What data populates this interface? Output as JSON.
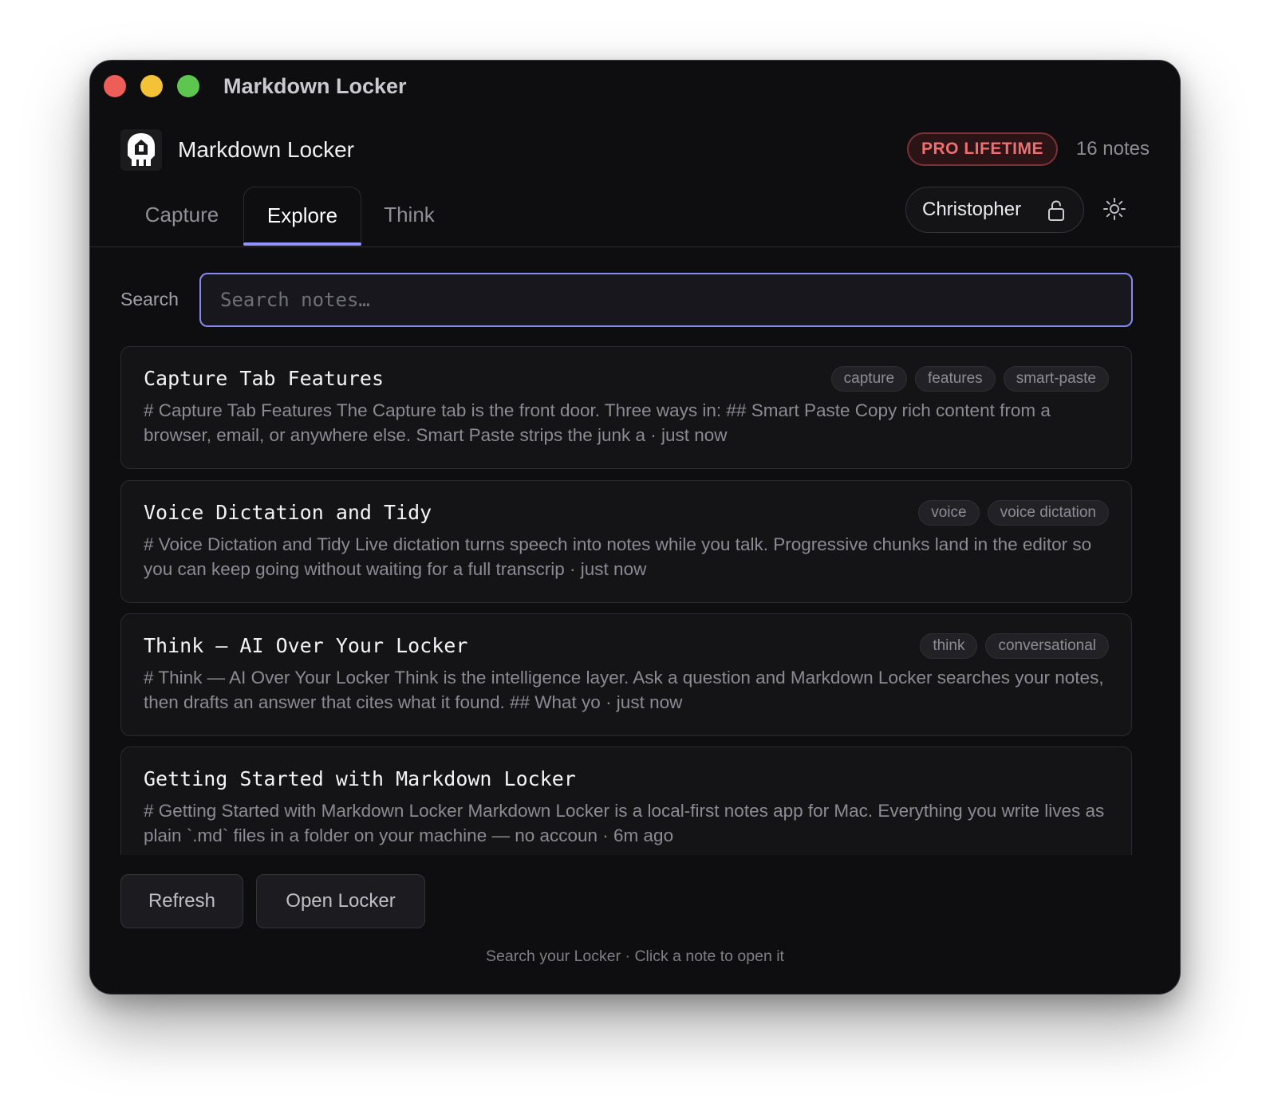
{
  "window": {
    "title": "Markdown Locker"
  },
  "header": {
    "app_name": "Markdown Locker",
    "plan_badge": "PRO LIFETIME",
    "note_count": "16 notes"
  },
  "tabs": [
    {
      "label": "Capture",
      "active": false
    },
    {
      "label": "Explore",
      "active": true
    },
    {
      "label": "Think",
      "active": false
    }
  ],
  "user": {
    "name": "Christopher"
  },
  "search": {
    "label": "Search",
    "placeholder": "Search notes…",
    "value": ""
  },
  "notes": [
    {
      "title": "Capture Tab Features",
      "tags": [
        "capture",
        "features",
        "smart-paste"
      ],
      "excerpt": "# Capture Tab Features The Capture tab is the front door. Three ways in: ## Smart Paste Copy rich content from a browser, email, or anywhere else. Smart Paste strips the junk a · just now"
    },
    {
      "title": "Voice Dictation and Tidy",
      "tags": [
        "voice",
        "voice dictation"
      ],
      "excerpt": "# Voice Dictation and Tidy Live dictation turns speech into notes while you talk. Progressive chunks land in the editor so you can keep going without waiting for a full transcrip · just now"
    },
    {
      "title": "Think — AI Over Your Locker",
      "tags": [
        "think",
        "conversational"
      ],
      "excerpt": "# Think — AI Over Your Locker Think is the intelligence layer. Ask a question and Markdown Locker searches your notes, then drafts an answer that cites what it found. ## What yo · just now"
    },
    {
      "title": "Getting Started with Markdown Locker",
      "tags": [],
      "excerpt": "# Getting Started with Markdown Locker Markdown Locker is a local-first notes app for Mac. Everything you write lives as plain `.md` files in a folder on your machine — no accoun · 6m ago"
    }
  ],
  "actions": {
    "refresh_label": "Refresh",
    "open_label": "Open Locker"
  },
  "footer": {
    "hint": "Search your Locker · Click a note to open it"
  },
  "colors": {
    "accent": "#858bf0",
    "badge_text": "#ee6f6f",
    "background": "#0e0e10"
  }
}
